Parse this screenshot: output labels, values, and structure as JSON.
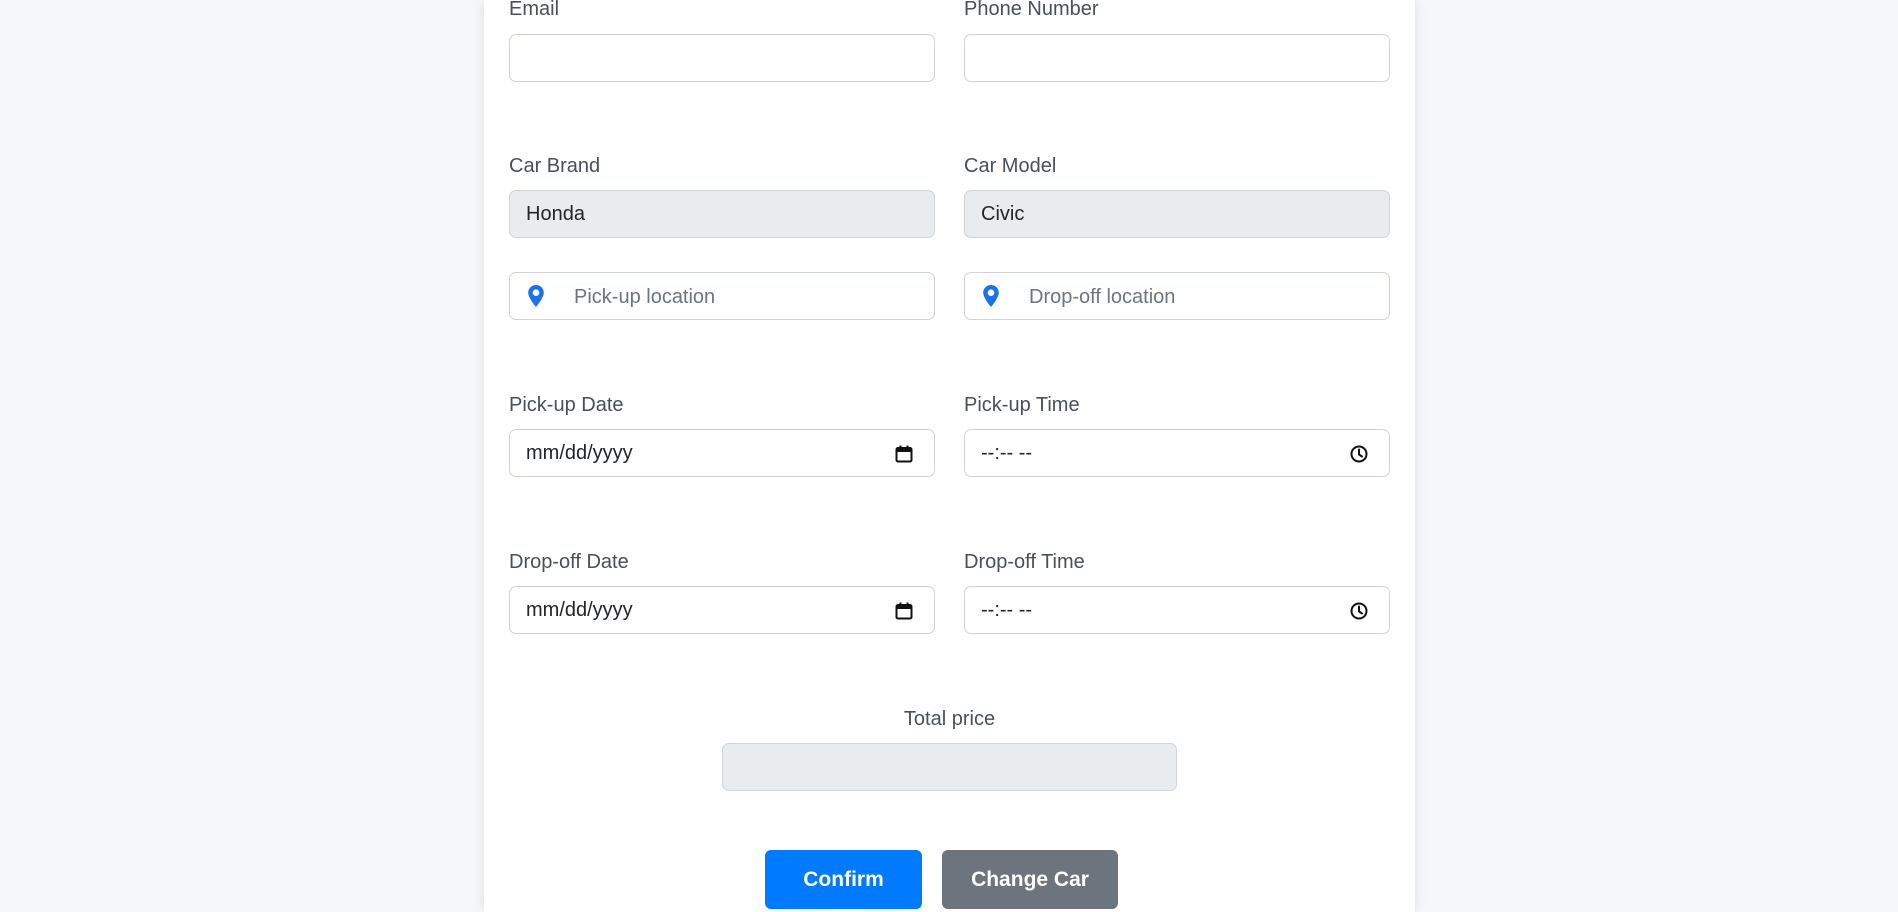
{
  "form": {
    "email": {
      "label": "Email",
      "value": ""
    },
    "phone": {
      "label": "Phone Number",
      "value": ""
    },
    "car_brand": {
      "label": "Car Brand",
      "value": "Honda"
    },
    "car_model": {
      "label": "Car Model",
      "value": "Civic"
    },
    "pickup_location": {
      "placeholder": "Pick-up location",
      "icon": "map-pin-icon"
    },
    "dropoff_location": {
      "placeholder": "Drop-off location",
      "icon": "map-pin-icon"
    },
    "pickup_date": {
      "label": "Pick-up Date",
      "value": "mm/dd/yyyy",
      "icon": "calendar-icon"
    },
    "pickup_time": {
      "label": "Pick-up Time",
      "value": "--:-- --",
      "icon": "clock-icon"
    },
    "dropoff_date": {
      "label": "Drop-off Date",
      "value": "mm/dd/yyyy",
      "icon": "calendar-icon"
    },
    "dropoff_time": {
      "label": "Drop-off Time",
      "value": "--:-- --",
      "icon": "clock-icon"
    },
    "total_price": {
      "label": "Total price",
      "value": ""
    }
  },
  "buttons": {
    "confirm_label": "Confirm",
    "change_car_label": "Change Car"
  },
  "colors": {
    "primary": "#007bff",
    "secondary": "#6c757d",
    "readonly_bg": "#e9ecef",
    "icon_blue": "#1a73e8"
  }
}
